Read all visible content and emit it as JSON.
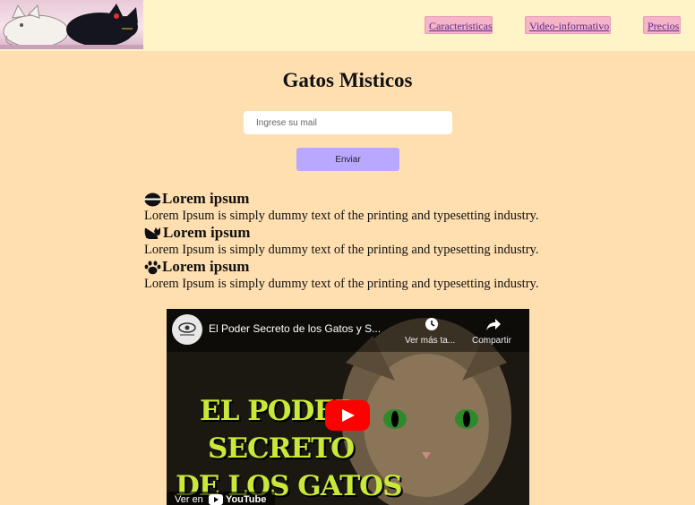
{
  "header": {
    "nav": [
      {
        "label": "Caracteristicas"
      },
      {
        "label": "Video-informativo"
      },
      {
        "label": "Precios"
      }
    ]
  },
  "main": {
    "title": "Gatos Misticos",
    "email_placeholder": "Ingrese su mail",
    "send_label": "Enviar",
    "features": [
      {
        "icon": "pot-icon",
        "heading": "Lorem ipsum",
        "text": "Lorem Ipsum is simply dummy text of the printing and typesetting industry."
      },
      {
        "icon": "cat-icon",
        "heading": "Lorem ipsum",
        "text": "Lorem Ipsum is simply dummy text of the printing and typesetting industry."
      },
      {
        "icon": "paw-icon",
        "heading": "Lorem ipsum",
        "text": "Lorem Ipsum is simply dummy text of the printing and typesetting industry."
      }
    ]
  },
  "video": {
    "title": "El Poder Secreto de los Gatos y S...",
    "watch_later": "Ver más ta...",
    "share": "Compartir",
    "thumb_lines": [
      "EL PODER",
      "SECRETO",
      "DE LOS GATOS"
    ],
    "watch_on": "Ver en",
    "youtube": "YouTube"
  },
  "colors": {
    "page_bg": "#ffdfb0",
    "header_bg": "#fff4c8",
    "nav_bg": "#f7b3c8",
    "button_bg": "#b8a8ff"
  }
}
